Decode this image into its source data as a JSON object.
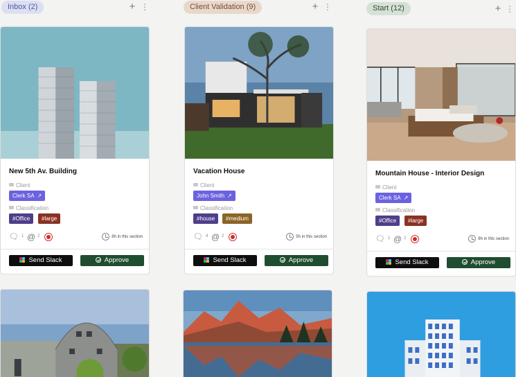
{
  "columns": [
    {
      "title": "Inbox (2)",
      "pill_bg": "#dcdff2",
      "pill_fg": "#4a5aa6",
      "cards": [
        {
          "title": "New 5th Av. Building",
          "client_label": "Client",
          "client": "Clerk SA",
          "classification_label": "Classification",
          "tags": [
            "#Office",
            "#large"
          ],
          "comments": "1",
          "mentions": "2",
          "time": "8h in this section",
          "slack_label": "Send Slack",
          "approve_label": "Approve"
        }
      ]
    },
    {
      "title": "Client Validation (9)",
      "pill_bg": "#e8d8cc",
      "pill_fg": "#7a4a30",
      "cards": [
        {
          "title": "Vacation House",
          "client_label": "Client",
          "client": "John Smith",
          "classification_label": "Classification",
          "tags": [
            "#house",
            "#medium"
          ],
          "comments": "4",
          "mentions": "2",
          "time": "5h in this section",
          "slack_label": "Send Slack",
          "approve_label": "Approve"
        }
      ]
    },
    {
      "title": "Start (12)",
      "pill_bg": "#d6e1d6",
      "pill_fg": "#2f4d33",
      "cards": [
        {
          "title": "Mountain House - Interior Design",
          "client_label": "Client",
          "client": "Clerk SA",
          "classification_label": "Classification",
          "tags": [
            "#Office",
            "#large"
          ],
          "comments": "1",
          "mentions": "2",
          "time": "8h in this section",
          "slack_label": "Send Slack",
          "approve_label": "Approve"
        }
      ]
    }
  ],
  "icons": {
    "add": "add-icon",
    "more": "more-vertical-icon",
    "external": "external-link-icon",
    "comment": "comment-icon",
    "mention": "at-sign-icon",
    "alert": "alert-icon",
    "clock": "clock-icon",
    "slack": "slack-icon",
    "check": "check-circle-icon"
  },
  "colors": {
    "client_tag": "#6b62e0",
    "tag_office": "#4f3f8a",
    "tag_large": "#8a3223",
    "tag_house": "#4f3f8a",
    "tag_medium": "#8c6428",
    "slack_button": "#0e0e0e",
    "approve_button": "#1f4d2f"
  }
}
